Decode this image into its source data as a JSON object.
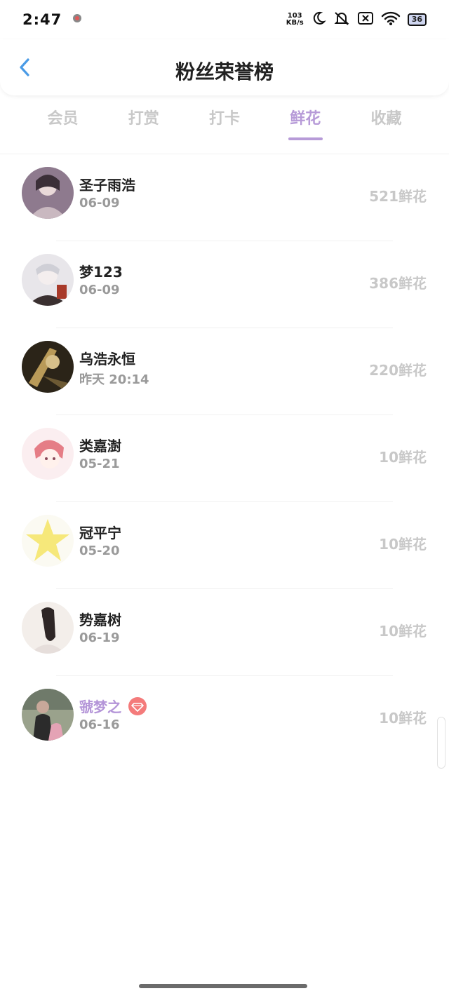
{
  "status_bar": {
    "time": "2:47",
    "net_speed_value": "103",
    "net_speed_unit": "KB/s",
    "battery": "36"
  },
  "header": {
    "title": "粉丝荣誉榜"
  },
  "tabs": [
    {
      "label": "会员",
      "active": false
    },
    {
      "label": "打赏",
      "active": false
    },
    {
      "label": "打卡",
      "active": false
    },
    {
      "label": "鲜花",
      "active": true
    },
    {
      "label": "收藏",
      "active": false
    }
  ],
  "list": [
    {
      "name": "圣子雨浩",
      "date": "06-09",
      "count": "521鲜花"
    },
    {
      "name": "梦123",
      "date": "06-09",
      "count": "386鲜花"
    },
    {
      "name": "乌浩永恒",
      "date": "昨天 20:14",
      "count": "220鲜花"
    },
    {
      "name": "类嘉澍",
      "date": "05-21",
      "count": "10鲜花"
    },
    {
      "name": "冠平宁",
      "date": "05-20",
      "count": "10鲜花"
    },
    {
      "name": "势嘉树",
      "date": "06-19",
      "count": "10鲜花"
    },
    {
      "name": "虢梦之",
      "date": "06-16",
      "count": "10鲜花"
    }
  ],
  "colors": {
    "accent": "#b79bd8",
    "vip_name": "#b495d8",
    "back_arrow": "#4a9be6",
    "badge": "#f47b7b"
  }
}
